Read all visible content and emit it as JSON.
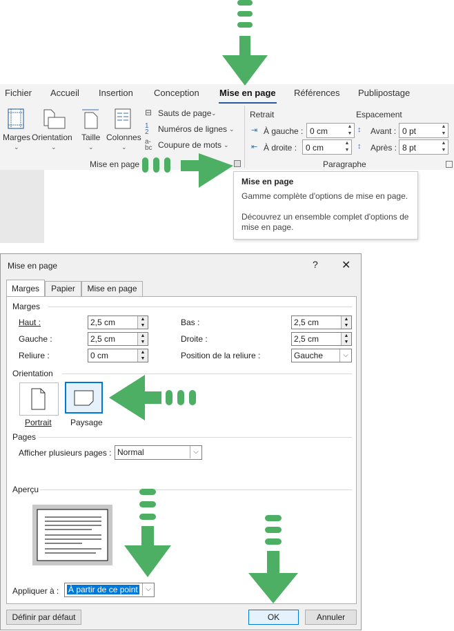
{
  "ribbon": {
    "tabs": [
      "Fichier",
      "Accueil",
      "Insertion",
      "Conception",
      "Mise en page",
      "Références",
      "Publipostage"
    ],
    "active_tab": "Mise en page",
    "buttons": {
      "margins": "Marges",
      "orientation": "Orientation",
      "size": "Taille",
      "columns": "Colonnes",
      "breaks": "Sauts de page",
      "line_numbers": "Numéros de lignes",
      "hyphenation": "Coupure de mots"
    },
    "group_page_setup": "Mise en page",
    "group_paragraph": "Paragraphe",
    "indent": {
      "title": "Retrait",
      "left_label": "À gauche :",
      "left_value": "0 cm",
      "right_label": "À droite :",
      "right_value": "0 cm"
    },
    "spacing": {
      "title": "Espacement",
      "before_label": "Avant :",
      "before_value": "0 pt",
      "after_label": "Après :",
      "after_value": "8 pt"
    }
  },
  "tooltip": {
    "title": "Mise en page",
    "line1": "Gamme complète d'options de mise en page.",
    "line2a": "Découvrez un ensemble complet d'options de",
    "line2b": "mise en page."
  },
  "dialog": {
    "title": "Mise en page",
    "help": "?",
    "close": "✕",
    "tabs": [
      "Marges",
      "Papier",
      "Mise en page"
    ],
    "margins_section": "Marges",
    "top_label": "Haut :",
    "top_value": "2,5 cm",
    "bottom_label": "Bas :",
    "bottom_value": "2,5 cm",
    "left_label": "Gauche :",
    "left_value": "2,5 cm",
    "right_label": "Droite :",
    "right_value": "2,5 cm",
    "gutter_label": "Reliure :",
    "gutter_value": "0 cm",
    "gutter_pos_label": "Position de la reliure :",
    "gutter_pos_value": "Gauche",
    "orientation_section": "Orientation",
    "portrait": "Portrait",
    "landscape": "Paysage",
    "pages_section": "Pages",
    "multiple_pages_label": "Afficher plusieurs pages :",
    "multiple_pages_value": "Normal",
    "preview_section": "Aperçu",
    "apply_label": "Appliquer à :",
    "apply_value": "À partir de ce point",
    "default_button": "Définir par défaut",
    "ok_button": "OK",
    "cancel_button": "Annuler"
  },
  "colors": {
    "accent": "#2b579a",
    "highlight_arrow": "#4caf63",
    "selection": "#0078d7"
  }
}
